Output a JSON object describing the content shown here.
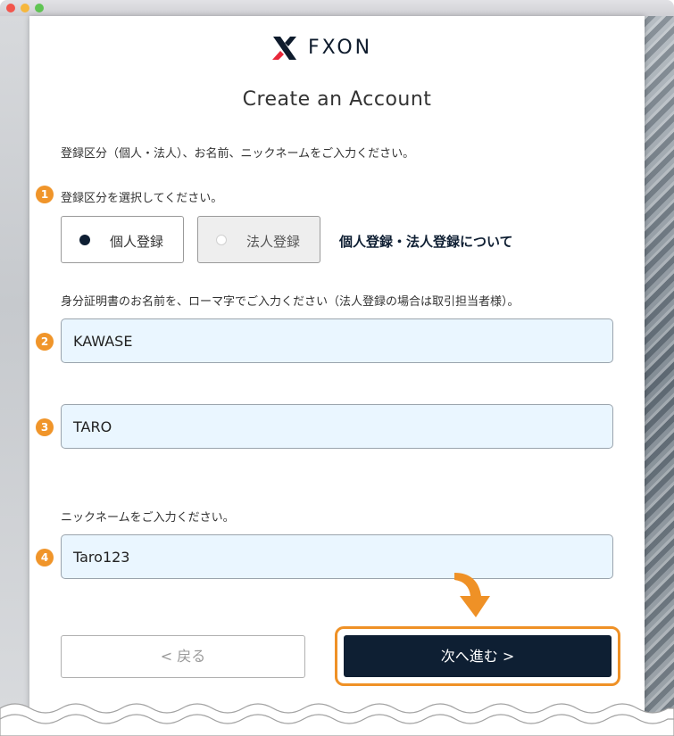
{
  "window": {
    "traffic_lights": [
      "close",
      "minimize",
      "zoom"
    ]
  },
  "brand": {
    "logo_text": "FXON",
    "logo_colors": {
      "x_dark": "#0e1b2c",
      "x_red": "#e8283a"
    }
  },
  "page": {
    "title": "Create an Account",
    "intro": "登録区分（個人・法人）、お名前、ニックネームをご入力ください。"
  },
  "step1": {
    "badge": "1",
    "label": "登録区分を選択してください。",
    "options": [
      {
        "label": "個人登録",
        "selected": true
      },
      {
        "label": "法人登録",
        "selected": false
      }
    ],
    "info_link": "個人登録・法人登録について"
  },
  "name_section": {
    "label": "身分証明書のお名前を、ローマ字でご入力ください（法人登録の場合は取引担当者様）。",
    "last_name": {
      "badge": "2",
      "value": "KAWASE"
    },
    "first_name": {
      "badge": "3",
      "value": "TARO"
    }
  },
  "nickname_section": {
    "label": "ニックネームをご入力ください。",
    "badge": "4",
    "value": "Taro123"
  },
  "buttons": {
    "back": "< 戻る",
    "next": "次へ進む >"
  },
  "colors": {
    "accent": "#f0952a",
    "primary": "#0e1f33",
    "field_bg": "#eaf6ff"
  }
}
